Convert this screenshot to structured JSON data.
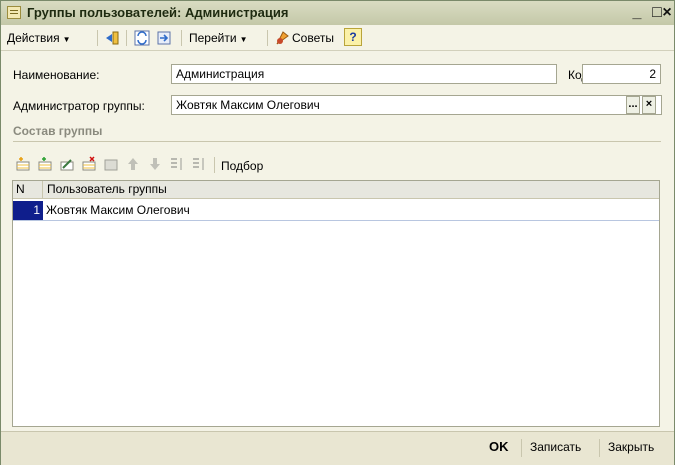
{
  "window": {
    "title": "Группы пользователей: Администрация"
  },
  "toolbar": {
    "actions_label": "Действия",
    "goto_label": "Перейти",
    "tips_label": "Советы",
    "help_glyph": "?"
  },
  "form": {
    "name_label": "Наименование:",
    "name_value": "Администрация",
    "code_label": "Код:",
    "code_value": "2",
    "admin_label": "Администратор группы:",
    "admin_value": "Жовтяк Максим Олегович",
    "select_glyph": "...",
    "clear_glyph": "×"
  },
  "section": {
    "title": "Состав группы",
    "pick_label": "Подбор"
  },
  "table": {
    "columns": [
      "N",
      "Пользователь группы"
    ],
    "rows": [
      {
        "n": "1",
        "user": "Жовтяк Максим Олегович"
      }
    ]
  },
  "footer": {
    "ok_label": "OK",
    "save_label": "Записать",
    "close_label": "Закрыть"
  }
}
